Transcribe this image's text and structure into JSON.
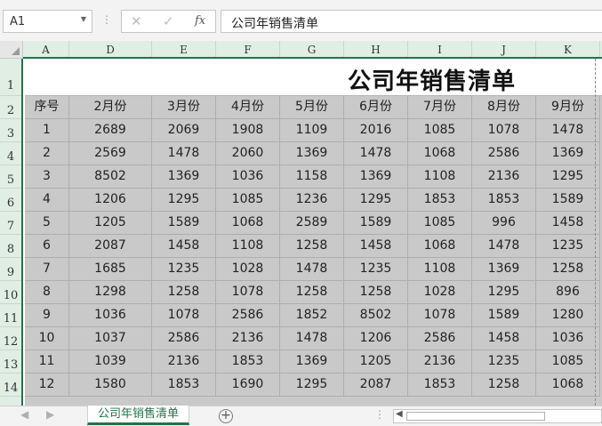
{
  "formula_bar": {
    "name_box": "A1",
    "separator": "⋮",
    "cancel_icon": "✕",
    "enter_icon": "✓",
    "fx_label": "fx",
    "formula_value": "公司年销售清单"
  },
  "grid": {
    "columns": [
      "A",
      "D",
      "E",
      "F",
      "G",
      "H",
      "I",
      "J",
      "K"
    ],
    "rows": [
      "1",
      "2",
      "3",
      "4",
      "5",
      "6",
      "7",
      "8",
      "9",
      "10",
      "11",
      "12",
      "13",
      "14"
    ],
    "title": "公司年销售清单",
    "headers": [
      "序号",
      "2月份",
      "3月份",
      "4月份",
      "5月份",
      "6月份",
      "7月份",
      "8月份",
      "9月份"
    ],
    "data_rows": [
      [
        "1",
        "2689",
        "2069",
        "1908",
        "1109",
        "2016",
        "1085",
        "1078",
        "1478"
      ],
      [
        "2",
        "2569",
        "1478",
        "2060",
        "1369",
        "1478",
        "1068",
        "2586",
        "1369"
      ],
      [
        "3",
        "8502",
        "1369",
        "1036",
        "1158",
        "1369",
        "1108",
        "2136",
        "1295"
      ],
      [
        "4",
        "1206",
        "1295",
        "1085",
        "1236",
        "1295",
        "1853",
        "1853",
        "1589"
      ],
      [
        "5",
        "1205",
        "1589",
        "1068",
        "2589",
        "1589",
        "1085",
        "996",
        "1458"
      ],
      [
        "6",
        "2087",
        "1458",
        "1108",
        "1258",
        "1458",
        "1068",
        "1478",
        "1235"
      ],
      [
        "7",
        "1685",
        "1235",
        "1028",
        "1478",
        "1235",
        "1108",
        "1369",
        "1258"
      ],
      [
        "8",
        "1298",
        "1258",
        "1078",
        "1258",
        "1258",
        "1028",
        "1295",
        "896"
      ],
      [
        "9",
        "1036",
        "1078",
        "2586",
        "1852",
        "8502",
        "1078",
        "1589",
        "1280"
      ],
      [
        "10",
        "1037",
        "2586",
        "2136",
        "1478",
        "1206",
        "2586",
        "1458",
        "1036"
      ],
      [
        "11",
        "1039",
        "2136",
        "1853",
        "1369",
        "1205",
        "2136",
        "1235",
        "1085"
      ],
      [
        "12",
        "1580",
        "1853",
        "1690",
        "1295",
        "2087",
        "1853",
        "1258",
        "1068"
      ]
    ]
  },
  "tab_bar": {
    "nav_prev": "◀",
    "nav_next": "▶",
    "sheet_tab": "公司年销售清单",
    "add_sheet": "+",
    "dots": "⋮",
    "scroll_left": "◀"
  },
  "colors": {
    "accent": "#217346",
    "header_bg": "#e0eee4",
    "data_fill": "#c9c9c9"
  }
}
